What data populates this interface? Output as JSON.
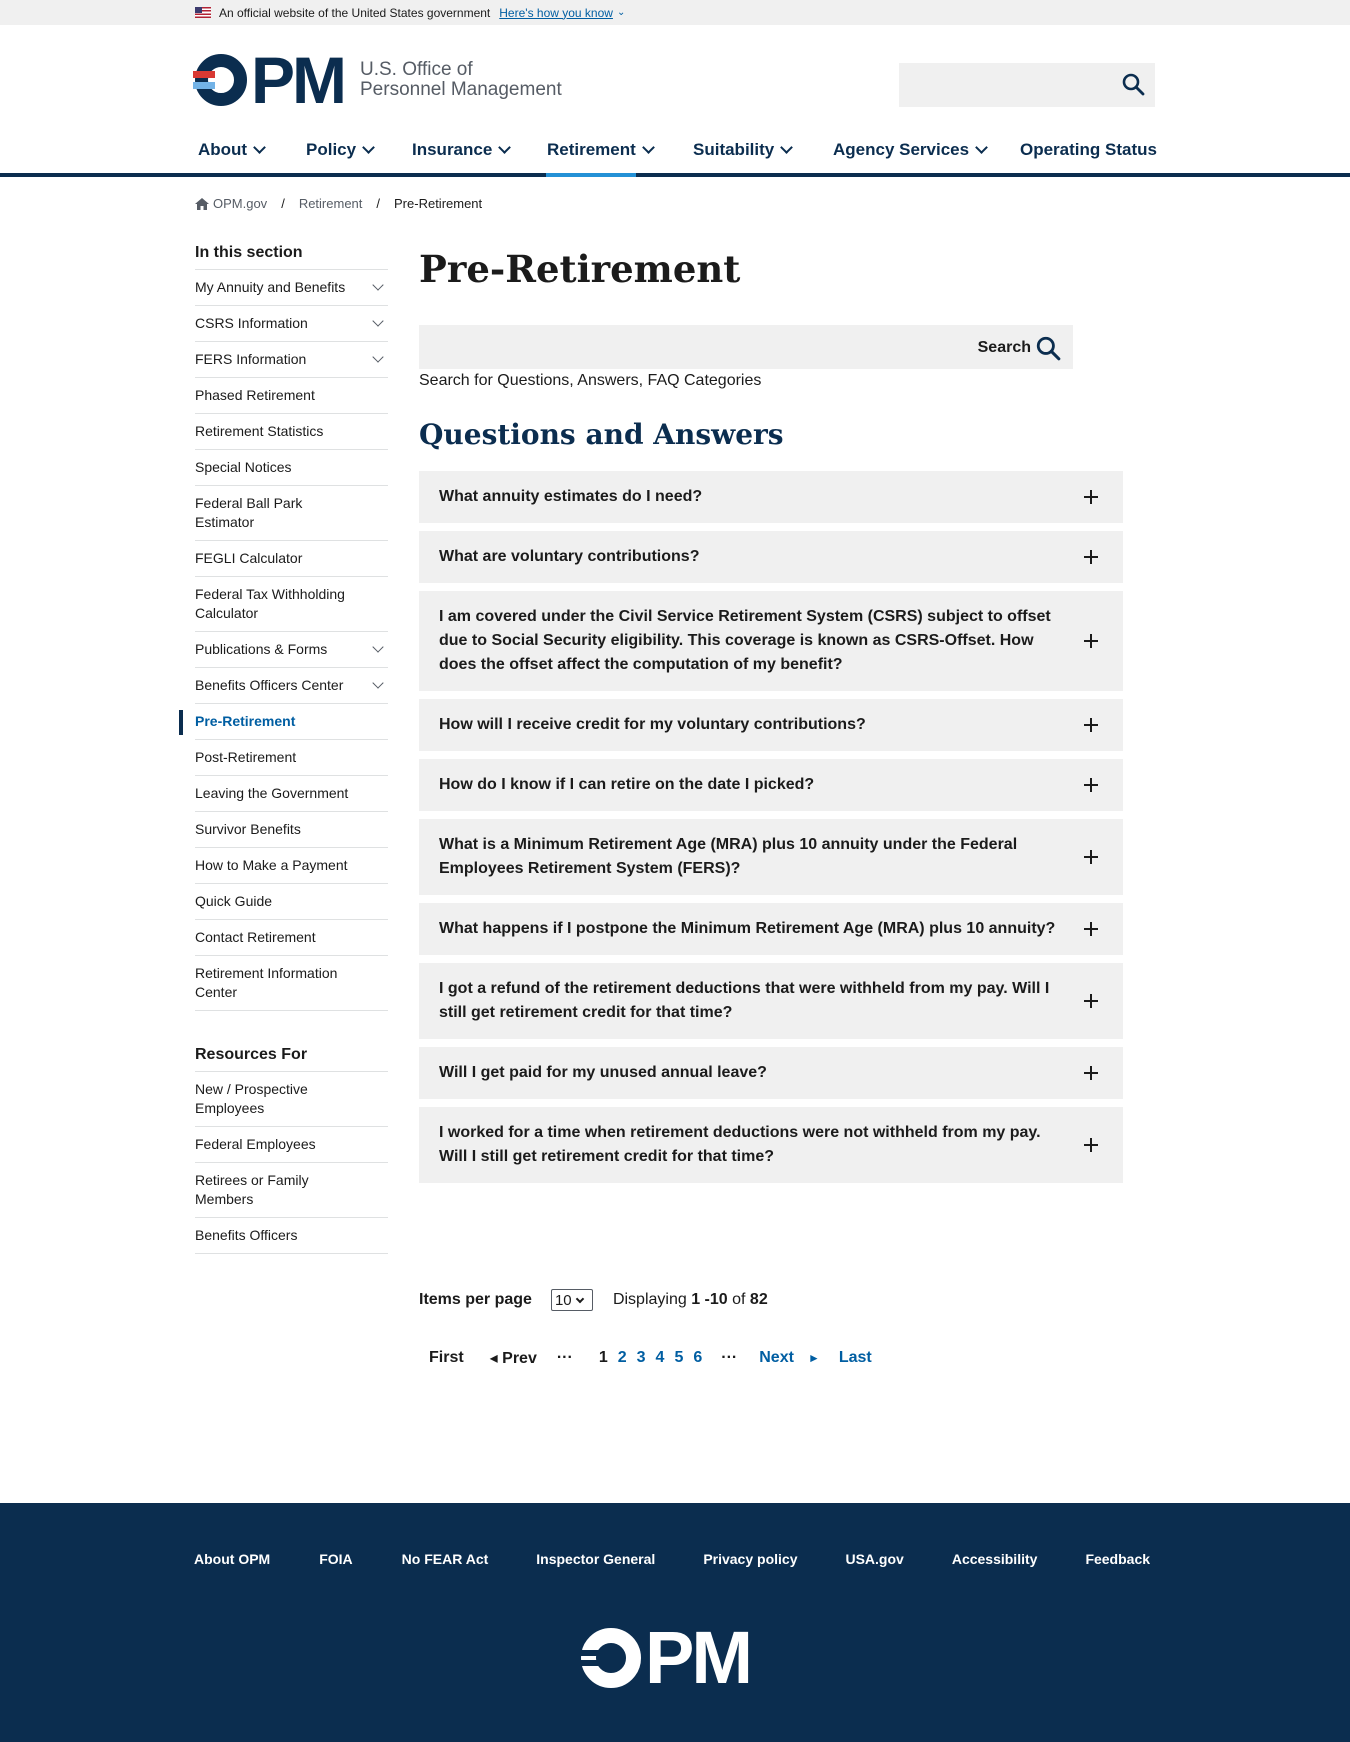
{
  "gov_banner": {
    "text": "An official website of the United States government",
    "link": "Here's how you know"
  },
  "header": {
    "logo_text": "PM",
    "agency_line1": "U.S. Office of",
    "agency_line2": "Personnel Management",
    "search_placeholder": ""
  },
  "nav": {
    "items": [
      {
        "label": "About"
      },
      {
        "label": "Policy"
      },
      {
        "label": "Insurance"
      },
      {
        "label": "Retirement"
      },
      {
        "label": "Suitability"
      },
      {
        "label": "Agency Services"
      },
      {
        "label": "Operating Status"
      }
    ],
    "active": "Retirement"
  },
  "breadcrumb": {
    "items": [
      "OPM.gov",
      "Retirement",
      "Pre-Retirement"
    ],
    "separator": "/"
  },
  "sidebar": {
    "section_title": "In this section",
    "items": [
      {
        "label": "My Annuity and Benefits"
      },
      {
        "label": "CSRS Information"
      },
      {
        "label": "FERS Information"
      },
      {
        "label": "Phased Retirement"
      },
      {
        "label": "Retirement Statistics"
      },
      {
        "label": "Special Notices"
      },
      {
        "label": "Federal Ball Park Estimator"
      },
      {
        "label": "FEGLI Calculator"
      },
      {
        "label": "Federal Tax Withholding Calculator"
      },
      {
        "label": "Publications & Forms"
      },
      {
        "label": "Benefits Officers Center"
      },
      {
        "label": "Pre-Retirement"
      },
      {
        "label": "Post-Retirement"
      },
      {
        "label": "Leaving the Government"
      },
      {
        "label": "Survivor Benefits"
      },
      {
        "label": "How to Make a Payment"
      },
      {
        "label": "Quick Guide"
      },
      {
        "label": "Contact Retirement"
      },
      {
        "label": "Retirement Information Center"
      }
    ],
    "resources_title": "Resources For",
    "resources": [
      {
        "label": "New / Prospective Employees"
      },
      {
        "label": "Federal Employees"
      },
      {
        "label": "Retirees or Family Members"
      },
      {
        "label": "Benefits Officers"
      }
    ]
  },
  "main": {
    "title": "Pre-Retirement",
    "search_button": "Search",
    "search_hint": "Search for Questions, Answers, FAQ Categories",
    "qa_heading": "Questions and Answers",
    "faqs": [
      "What annuity estimates do I need?",
      "What are voluntary contributions?",
      "I am covered under the Civil Service Retirement System (CSRS) subject to offset due to Social Security eligibility. This coverage is known as CSRS-Offset. How does the offset affect the computation of my benefit?",
      "How will I receive credit for my voluntary contributions?",
      "How do I know if I can retire on the date I picked?",
      "What is a Minimum Retirement Age (MRA) plus 10 annuity under the Federal Employees Retirement System (FERS)?",
      "What happens if I postpone the Minimum Retirement Age (MRA) plus 10 annuity?",
      "I got a refund of the retirement deductions that were withheld from my pay. Will I still get retirement credit for that time?",
      "Will I get paid for my unused annual leave?",
      "I worked for a time when retirement deductions were not withheld from my pay. Will I still get retirement credit for that time?"
    ]
  },
  "pager": {
    "items_per_page_label": "Items per page",
    "items_per_page_value": "10",
    "displaying_prefix": "Displaying",
    "range": "1 -10",
    "of": "of",
    "total": "82",
    "first": "First",
    "prev": "◂ Prev",
    "ellipsis": "···",
    "current_page": "1",
    "pages": [
      "2",
      "3",
      "4",
      "5",
      "6"
    ],
    "next": "Next",
    "next_arrow": "►",
    "last": "Last"
  },
  "footer": {
    "links": [
      "About OPM",
      "FOIA",
      "No FEAR Act",
      "Inspector General",
      "Privacy policy",
      "USA.gov",
      "Accessibility",
      "Feedback"
    ],
    "logo_text": "PM"
  },
  "colors": {
    "navy": "#0b2d4f",
    "link_blue": "#005ea2",
    "active_tab": "#2491d6",
    "logo_red": "#d83933",
    "logo_light_blue": "#73b3e7",
    "panel_gray": "#f0f0f0"
  },
  "icons": [
    "us-flag-icon",
    "search-icon",
    "chevron-down-icon",
    "home-icon",
    "plus-icon"
  ]
}
